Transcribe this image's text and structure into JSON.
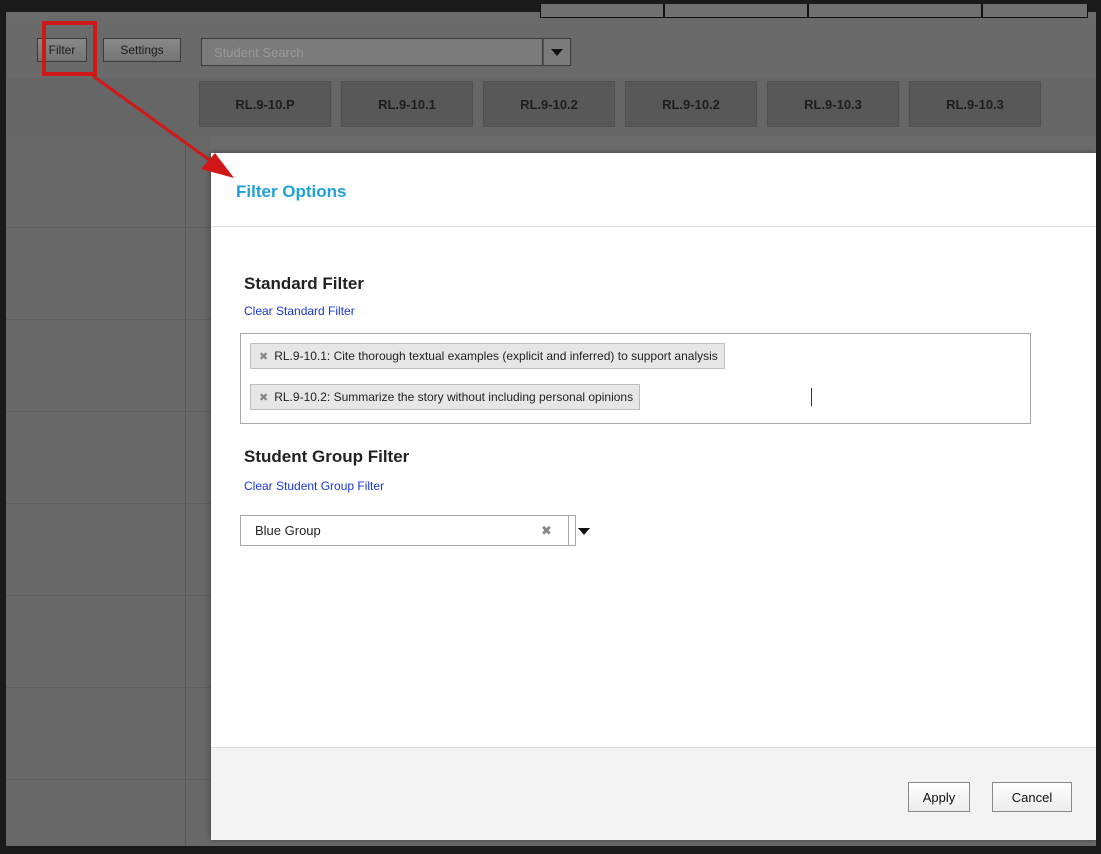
{
  "toolbar": {
    "filter_label": "Filter",
    "settings_label": "Settings",
    "search_placeholder": "Student Search"
  },
  "columns": [
    "RL.9-10.P",
    "RL.9-10.1",
    "RL.9-10.2",
    "RL.9-10.2",
    "RL.9-10.3",
    "RL.9-10.3"
  ],
  "modal": {
    "title": "Filter Options",
    "standard_filter": {
      "title": "Standard Filter",
      "clear_label": "Clear Standard Filter",
      "tags": [
        "RL.9-10.1: Cite thorough textual examples (explicit and inferred) to support analysis",
        "RL.9-10.2: Summarize the story without including personal opinions"
      ]
    },
    "student_group_filter": {
      "title": "Student Group Filter",
      "clear_label": "Clear Student Group Filter",
      "selected": "Blue Group"
    },
    "apply_label": "Apply",
    "cancel_label": "Cancel"
  },
  "icons": {
    "tag_remove": "close-icon",
    "dropdown": "chevron-down-icon"
  },
  "colors": {
    "title_blue": "#1ea0d8",
    "link_blue": "#1a35d6",
    "annotation_red": "#d01818",
    "overlay_gray": "#6b6b6b"
  }
}
